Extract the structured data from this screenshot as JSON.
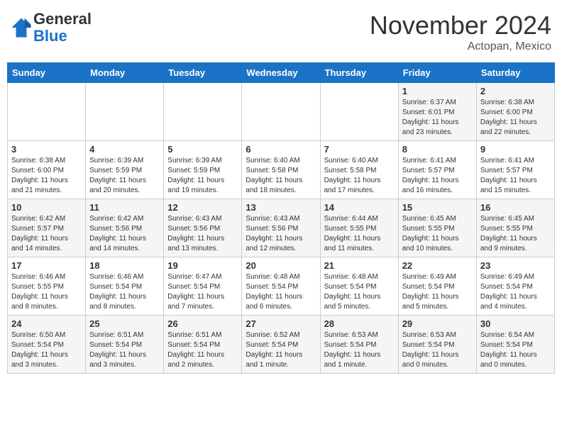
{
  "header": {
    "logo_general": "General",
    "logo_blue": "Blue",
    "month_title": "November 2024",
    "subtitle": "Actopan, Mexico"
  },
  "days_of_week": [
    "Sunday",
    "Monday",
    "Tuesday",
    "Wednesday",
    "Thursday",
    "Friday",
    "Saturday"
  ],
  "weeks": [
    [
      {
        "day": "",
        "info": ""
      },
      {
        "day": "",
        "info": ""
      },
      {
        "day": "",
        "info": ""
      },
      {
        "day": "",
        "info": ""
      },
      {
        "day": "",
        "info": ""
      },
      {
        "day": "1",
        "info": "Sunrise: 6:37 AM\nSunset: 6:01 PM\nDaylight: 11 hours and 23 minutes."
      },
      {
        "day": "2",
        "info": "Sunrise: 6:38 AM\nSunset: 6:00 PM\nDaylight: 11 hours and 22 minutes."
      }
    ],
    [
      {
        "day": "3",
        "info": "Sunrise: 6:38 AM\nSunset: 6:00 PM\nDaylight: 11 hours and 21 minutes."
      },
      {
        "day": "4",
        "info": "Sunrise: 6:39 AM\nSunset: 5:59 PM\nDaylight: 11 hours and 20 minutes."
      },
      {
        "day": "5",
        "info": "Sunrise: 6:39 AM\nSunset: 5:59 PM\nDaylight: 11 hours and 19 minutes."
      },
      {
        "day": "6",
        "info": "Sunrise: 6:40 AM\nSunset: 5:58 PM\nDaylight: 11 hours and 18 minutes."
      },
      {
        "day": "7",
        "info": "Sunrise: 6:40 AM\nSunset: 5:58 PM\nDaylight: 11 hours and 17 minutes."
      },
      {
        "day": "8",
        "info": "Sunrise: 6:41 AM\nSunset: 5:57 PM\nDaylight: 11 hours and 16 minutes."
      },
      {
        "day": "9",
        "info": "Sunrise: 6:41 AM\nSunset: 5:57 PM\nDaylight: 11 hours and 15 minutes."
      }
    ],
    [
      {
        "day": "10",
        "info": "Sunrise: 6:42 AM\nSunset: 5:57 PM\nDaylight: 11 hours and 14 minutes."
      },
      {
        "day": "11",
        "info": "Sunrise: 6:42 AM\nSunset: 5:56 PM\nDaylight: 11 hours and 14 minutes."
      },
      {
        "day": "12",
        "info": "Sunrise: 6:43 AM\nSunset: 5:56 PM\nDaylight: 11 hours and 13 minutes."
      },
      {
        "day": "13",
        "info": "Sunrise: 6:43 AM\nSunset: 5:56 PM\nDaylight: 11 hours and 12 minutes."
      },
      {
        "day": "14",
        "info": "Sunrise: 6:44 AM\nSunset: 5:55 PM\nDaylight: 11 hours and 11 minutes."
      },
      {
        "day": "15",
        "info": "Sunrise: 6:45 AM\nSunset: 5:55 PM\nDaylight: 11 hours and 10 minutes."
      },
      {
        "day": "16",
        "info": "Sunrise: 6:45 AM\nSunset: 5:55 PM\nDaylight: 11 hours and 9 minutes."
      }
    ],
    [
      {
        "day": "17",
        "info": "Sunrise: 6:46 AM\nSunset: 5:55 PM\nDaylight: 11 hours and 8 minutes."
      },
      {
        "day": "18",
        "info": "Sunrise: 6:46 AM\nSunset: 5:54 PM\nDaylight: 11 hours and 8 minutes."
      },
      {
        "day": "19",
        "info": "Sunrise: 6:47 AM\nSunset: 5:54 PM\nDaylight: 11 hours and 7 minutes."
      },
      {
        "day": "20",
        "info": "Sunrise: 6:48 AM\nSunset: 5:54 PM\nDaylight: 11 hours and 6 minutes."
      },
      {
        "day": "21",
        "info": "Sunrise: 6:48 AM\nSunset: 5:54 PM\nDaylight: 11 hours and 5 minutes."
      },
      {
        "day": "22",
        "info": "Sunrise: 6:49 AM\nSunset: 5:54 PM\nDaylight: 11 hours and 5 minutes."
      },
      {
        "day": "23",
        "info": "Sunrise: 6:49 AM\nSunset: 5:54 PM\nDaylight: 11 hours and 4 minutes."
      }
    ],
    [
      {
        "day": "24",
        "info": "Sunrise: 6:50 AM\nSunset: 5:54 PM\nDaylight: 11 hours and 3 minutes."
      },
      {
        "day": "25",
        "info": "Sunrise: 6:51 AM\nSunset: 5:54 PM\nDaylight: 11 hours and 3 minutes."
      },
      {
        "day": "26",
        "info": "Sunrise: 6:51 AM\nSunset: 5:54 PM\nDaylight: 11 hours and 2 minutes."
      },
      {
        "day": "27",
        "info": "Sunrise: 6:52 AM\nSunset: 5:54 PM\nDaylight: 11 hours and 1 minute."
      },
      {
        "day": "28",
        "info": "Sunrise: 6:53 AM\nSunset: 5:54 PM\nDaylight: 11 hours and 1 minute."
      },
      {
        "day": "29",
        "info": "Sunrise: 6:53 AM\nSunset: 5:54 PM\nDaylight: 11 hours and 0 minutes."
      },
      {
        "day": "30",
        "info": "Sunrise: 6:54 AM\nSunset: 5:54 PM\nDaylight: 11 hours and 0 minutes."
      }
    ]
  ]
}
